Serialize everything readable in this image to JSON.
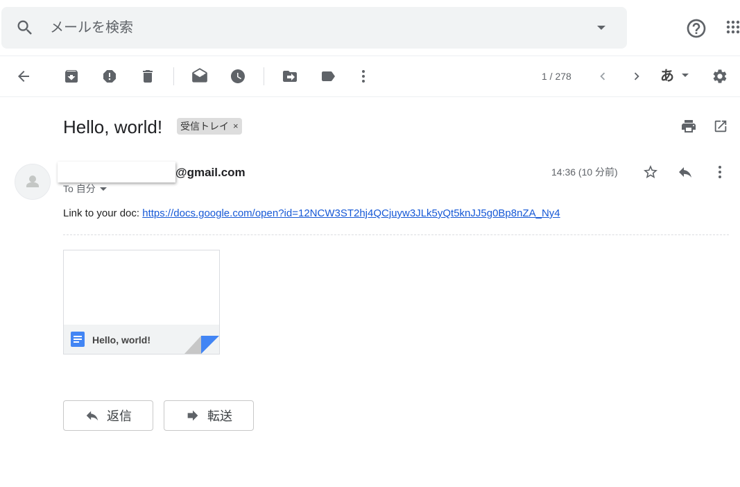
{
  "search": {
    "placeholder": "メールを検索"
  },
  "toolbar": {
    "page_counter": "1 / 278",
    "ime_label": "あ"
  },
  "message": {
    "subject": "Hello, world!",
    "label_chip": "受信トレイ",
    "label_remove": "×",
    "sender_email_suffix": "@gmail.com",
    "to_prefix": "To",
    "to_recipient": "自分",
    "timestamp": "14:36 (10 分前)",
    "body_prefix": "Link to your doc: ",
    "body_link": "https://docs.google.com/open?id=12NCW3ST2hj4QCjuyw3JLk5yQt5knJJ5g0Bp8nZA_Ny4"
  },
  "attachment": {
    "name": "Hello, world!"
  },
  "actions": {
    "reply_label": "返信",
    "forward_label": "転送"
  },
  "colors": {
    "doc_blue": "#4285f4",
    "link": "#1558d6",
    "icon_gray": "#5f6368"
  },
  "icons": [
    "search-icon",
    "dropdown-icon",
    "help-icon",
    "apps-icon",
    "back-icon",
    "archive-icon",
    "report-spam-icon",
    "delete-icon",
    "mark-unread-icon",
    "snooze-icon",
    "move-to-icon",
    "label-icon",
    "more-icon",
    "prev-icon",
    "next-icon",
    "settings-icon",
    "print-icon",
    "open-new-window-icon",
    "star-icon",
    "reply-icon",
    "forward-icon",
    "docs-icon"
  ]
}
